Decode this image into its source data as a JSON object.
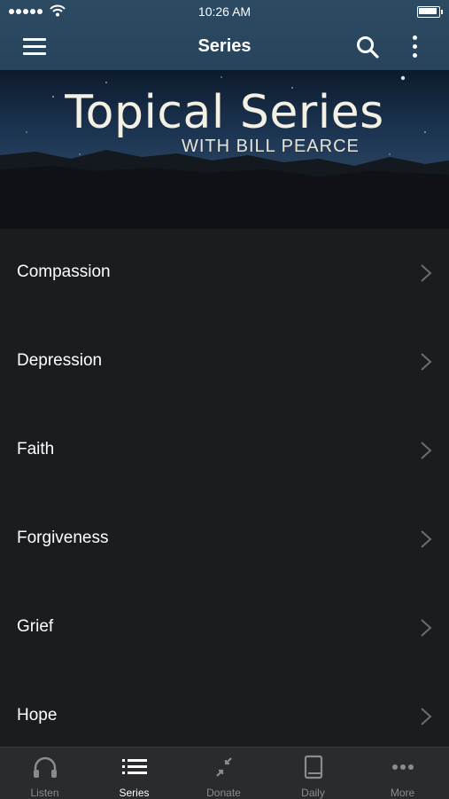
{
  "status_bar": {
    "time": "10:26 AM"
  },
  "nav": {
    "title": "Series"
  },
  "banner": {
    "title": "Topical Series",
    "subtitle": "WITH BILL PEARCE"
  },
  "series": [
    {
      "label": "Compassion"
    },
    {
      "label": "Depression"
    },
    {
      "label": "Faith"
    },
    {
      "label": "Forgiveness"
    },
    {
      "label": "Grief"
    },
    {
      "label": "Hope"
    }
  ],
  "tabs": [
    {
      "label": "Listen",
      "icon": "headphones-icon"
    },
    {
      "label": "Series",
      "icon": "list-icon"
    },
    {
      "label": "Donate",
      "icon": "donate-icon"
    },
    {
      "label": "Daily",
      "icon": "book-icon"
    },
    {
      "label": "More",
      "icon": "ellipsis-icon"
    }
  ],
  "colors": {
    "header": "#2d4a63",
    "background": "#1b1c1e",
    "tab_bar": "#2a2b2d",
    "inactive_tab": "#8a8b8e"
  }
}
